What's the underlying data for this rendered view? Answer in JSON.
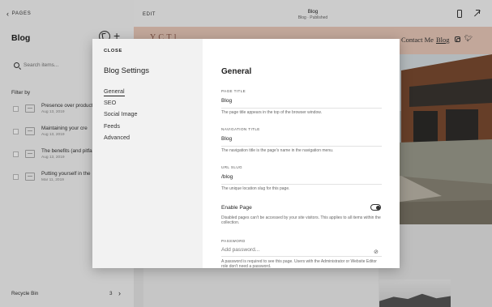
{
  "pages_panel": {
    "back_label": "PAGES",
    "title": "Blog",
    "search_placeholder": "Search items...",
    "filter_label": "Filter by",
    "posts": [
      {
        "title": "Presence over product",
        "date": "Aug 13, 2019"
      },
      {
        "title": "Maintaining your cre",
        "date": "Aug 13, 2019"
      },
      {
        "title": "The benefits (and pitfal",
        "date": "Aug 13, 2019"
      },
      {
        "title": "Putting yourself in the",
        "date": "Mar 11, 2019"
      }
    ],
    "recycle_bin_label": "Recycle Bin",
    "recycle_bin_count": "3"
  },
  "editor_bar": {
    "edit_label": "EDIT",
    "page_name": "Blog",
    "page_status": "Blog · Published"
  },
  "site_preview": {
    "logo_text": "Y      C     T  l",
    "nav_contact": "Contact Me",
    "nav_blog": "Blog"
  },
  "dialog": {
    "close_label": "CLOSE",
    "title": "Blog Settings",
    "tabs": [
      "General",
      "SEO",
      "Social Image",
      "Feeds",
      "Advanced"
    ],
    "active_tab": "General",
    "section_title": "General",
    "page_title": {
      "label": "PAGE TITLE",
      "value": "Blog",
      "help": "The page title appears in the top of the browser window."
    },
    "navigation_title": {
      "label": "NAVIGATION TITLE",
      "value": "Blog",
      "help": "The navigation title is the page's name in the navigation menu."
    },
    "url_slug": {
      "label": "URL SLUG",
      "value": "/blog",
      "help": "The unique location slug for this page."
    },
    "enable_page": {
      "label": "Enable Page",
      "enabled": true,
      "help": "Disabled pages can't be accessed by your site visitors. This applies to all items within the collection."
    },
    "password": {
      "label": "PASSWORD",
      "placeholder": "Add password...",
      "help": "A password is required to see this page. Users with the Administrator or Website Editor role don't need a password."
    }
  },
  "colors": {
    "site_header_bg": "#e8c8b8",
    "dialog_sidebar_bg": "#f2f2f2",
    "accent": "#222222"
  }
}
